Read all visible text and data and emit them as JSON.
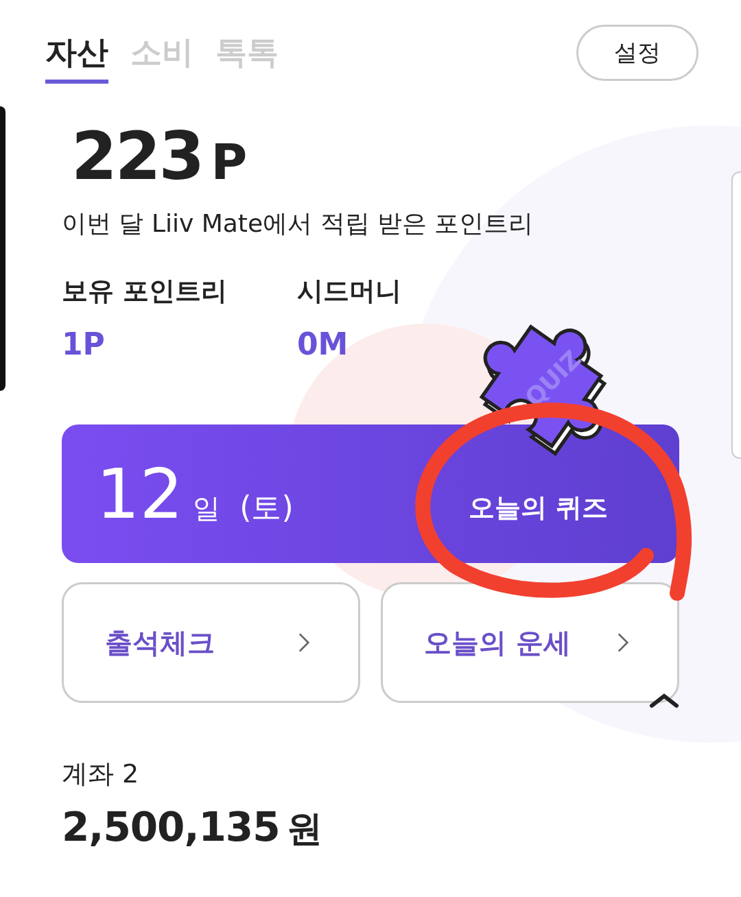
{
  "tabs": [
    {
      "label": "자산",
      "selected": true
    },
    {
      "label": "소비",
      "selected": false
    },
    {
      "label": "톡톡",
      "selected": false
    }
  ],
  "settings_button": "설정",
  "points": {
    "value": "223",
    "unit": "P",
    "caption": "이번 달 Liiv Mate에서 적립 받은 포인트리"
  },
  "balances": [
    {
      "label": "보유 포인트리",
      "value": "1P"
    },
    {
      "label": "시드머니",
      "value": "0M"
    }
  ],
  "quiz_banner": {
    "day": "12",
    "day_unit": "일",
    "weekday": "(토)",
    "action": "오늘의 퀴즈",
    "puzzle_label": "QUIZ"
  },
  "shortcuts": [
    {
      "label": "출석체크"
    },
    {
      "label": "오늘의 운세"
    }
  ],
  "account": {
    "title": "계좌 2",
    "amount": "2,500,135",
    "currency": "원"
  }
}
